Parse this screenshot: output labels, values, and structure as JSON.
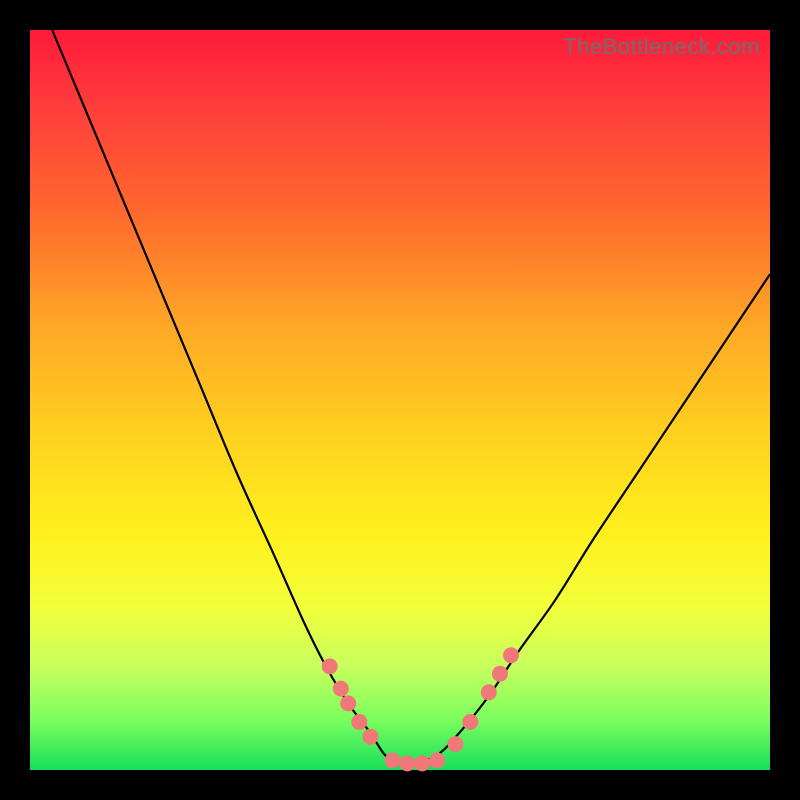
{
  "watermark": "TheBottleneck.com",
  "colors": {
    "frame_bg": "#000000",
    "gradient_top": "#ff1a3a",
    "gradient_bottom": "#18e05a",
    "curve": "#000000",
    "dot": "#f07878"
  },
  "chart_data": {
    "type": "line",
    "title": "",
    "xlabel": "",
    "ylabel": "",
    "xlim": [
      0,
      100
    ],
    "ylim": [
      0,
      100
    ],
    "legend": false,
    "grid": false,
    "series": [
      {
        "name": "bottleneck-curve",
        "x": [
          3,
          8,
          13,
          18,
          23,
          28,
          33,
          37,
          40,
          43,
          46,
          48,
          50,
          52,
          55,
          58,
          62,
          66,
          71,
          76,
          82,
          88,
          94,
          100
        ],
        "y": [
          100,
          88,
          76,
          64,
          52,
          40,
          29,
          20,
          14,
          9,
          5,
          2,
          1,
          1,
          2,
          5,
          10,
          16,
          23,
          31,
          40,
          49,
          58,
          67
        ]
      }
    ],
    "annotations": [],
    "dots": [
      {
        "x": 40.5,
        "y": 14
      },
      {
        "x": 42,
        "y": 11
      },
      {
        "x": 43,
        "y": 9
      },
      {
        "x": 44.5,
        "y": 6.5
      },
      {
        "x": 46,
        "y": 4.5
      },
      {
        "x": 49,
        "y": 1.3
      },
      {
        "x": 51,
        "y": 0.9
      },
      {
        "x": 53,
        "y": 0.9
      },
      {
        "x": 55,
        "y": 1.3
      },
      {
        "x": 57.5,
        "y": 3.5
      },
      {
        "x": 59.5,
        "y": 6.5
      },
      {
        "x": 62,
        "y": 10.5
      },
      {
        "x": 63.5,
        "y": 13
      },
      {
        "x": 65,
        "y": 15.5
      }
    ]
  }
}
